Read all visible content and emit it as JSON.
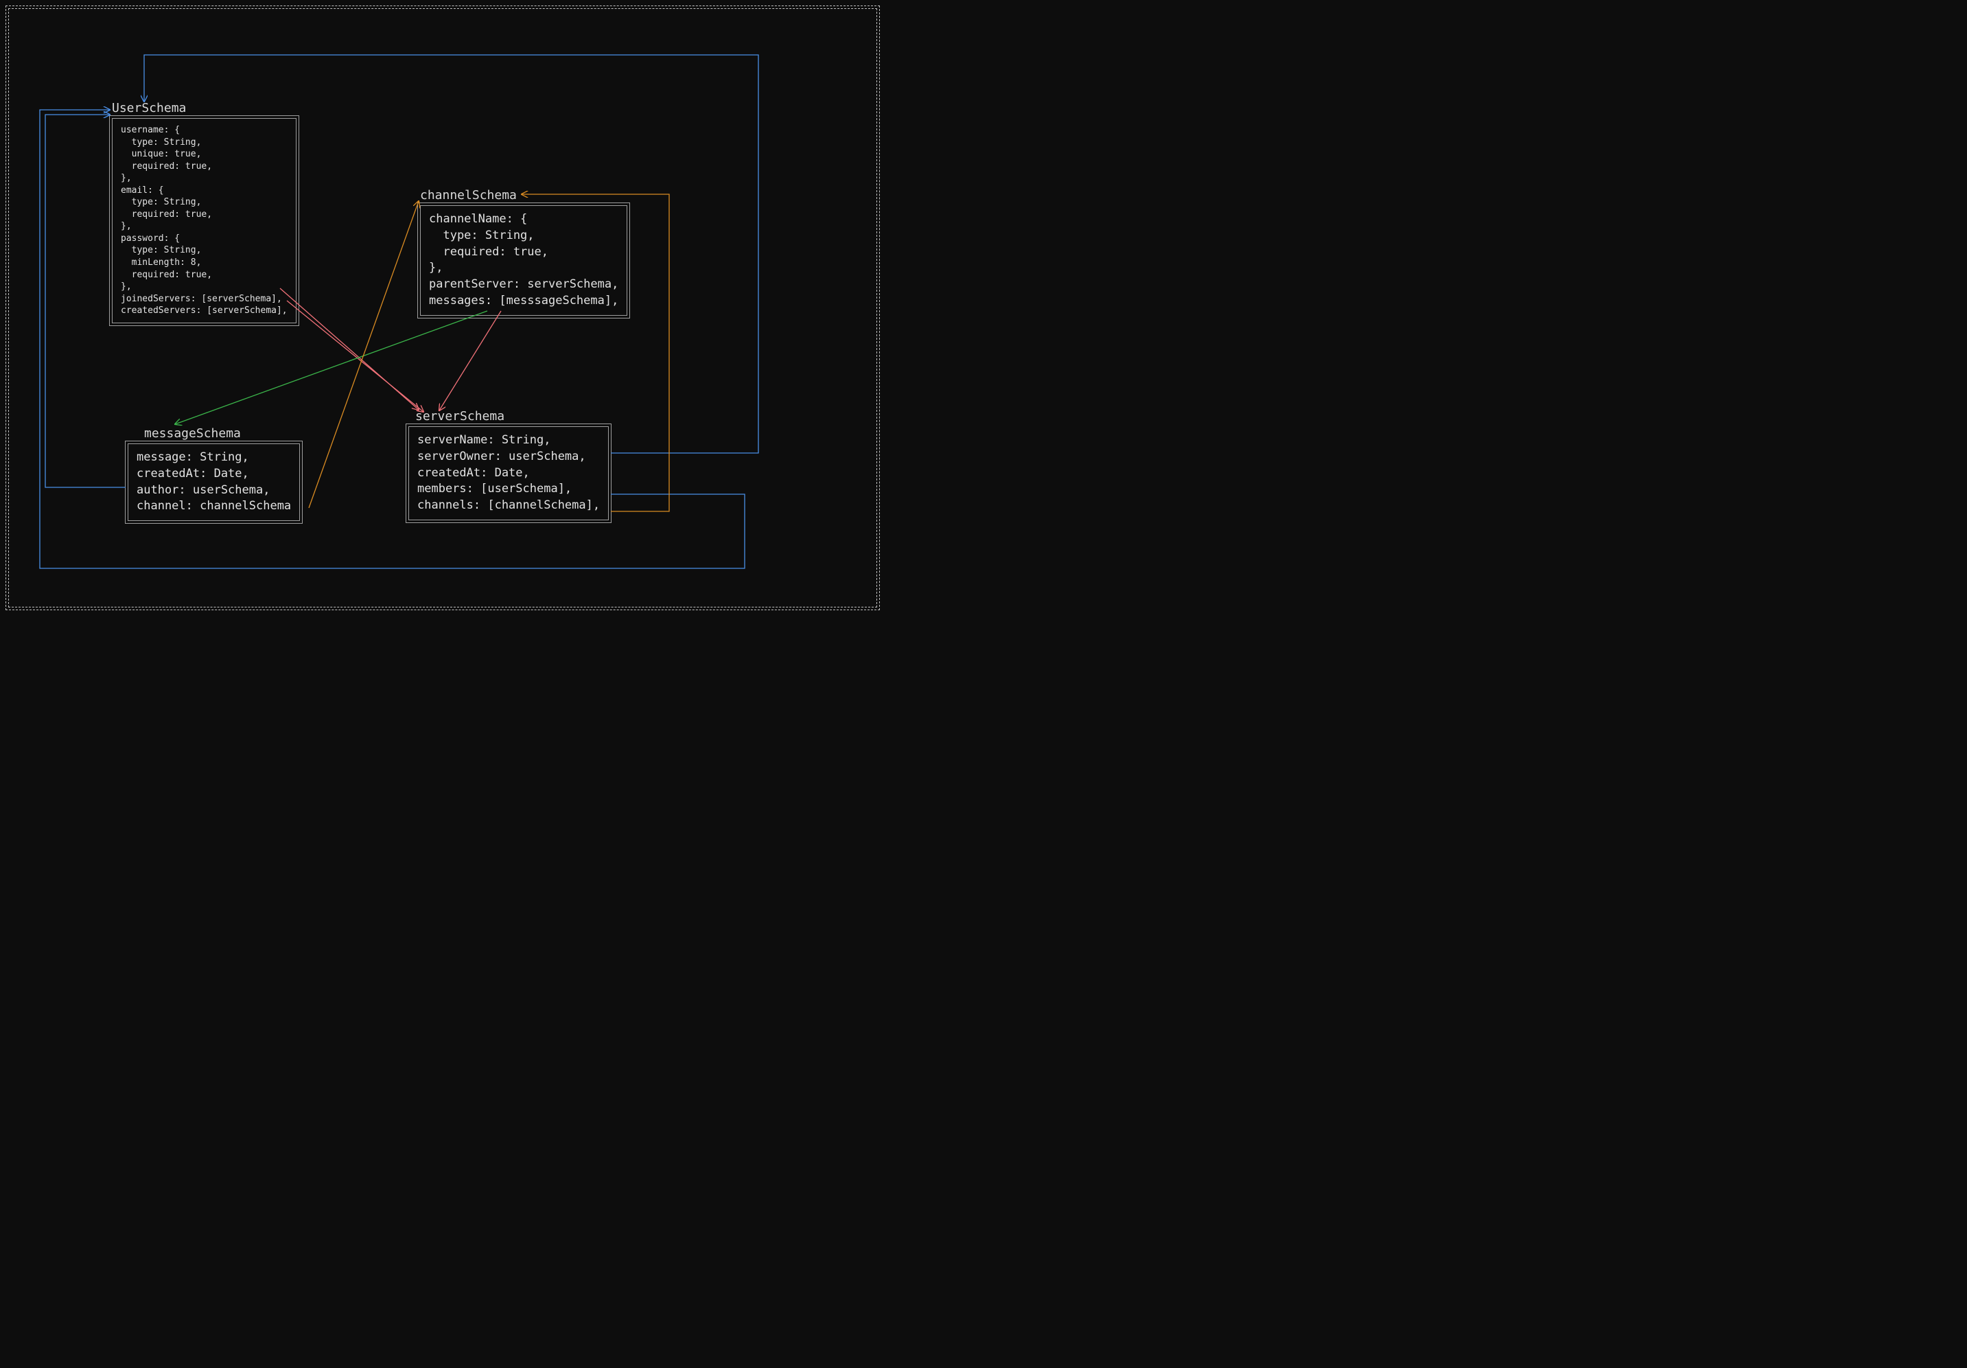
{
  "user": {
    "title": "UserSchema",
    "body": "username: {\n  type: String,\n  unique: true,\n  required: true,\n},\nemail: {\n  type: String,\n  required: true,\n},\npassword: {\n  type: String,\n  minLength: 8,\n  required: true,\n},\njoinedServers: [serverSchema],\ncreatedServers: [serverSchema],"
  },
  "channel": {
    "title": "channelSchema",
    "body": "channelName: {\n  type: String,\n  required: true,\n},\nparentServer: serverSchema,\nmessages: [messsageSchema],"
  },
  "message": {
    "title": "messageSchema",
    "body": "message: String,\ncreatedAt: Date,\nauthor: userSchema,\nchannel: channelSchema"
  },
  "server": {
    "title": "serverSchema",
    "body": "serverName: String,\nserverOwner: userSchema,\ncreatedAt: Date,\nmembers: [userSchema],\nchannels: [channelSchema],"
  },
  "colors": {
    "blue": "#4a8fe7",
    "green": "#3bb54a",
    "orange": "#d98b22",
    "pink": "#f07178"
  }
}
